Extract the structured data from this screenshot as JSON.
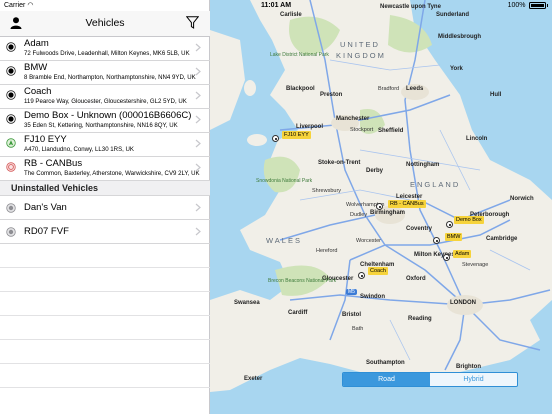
{
  "status_bar": {
    "carrier": "Carrier",
    "time": "11:01 AM",
    "battery": "100%"
  },
  "navbar": {
    "title": "Vehicles"
  },
  "vehicles_installed": [
    {
      "name": "Adam",
      "address": "72 Fulwoods Drive, Leadenhall, Milton Keynes, MK6 5LB, UK",
      "status": "online"
    },
    {
      "name": "BMW",
      "address": "8 Bramble End, Northampton, Northamptonshire, NN4 9YD, UK",
      "status": "online"
    },
    {
      "name": "Coach",
      "address": "119 Pearce Way, Gloucester, Gloucestershire, GL2 5YD, UK",
      "status": "online"
    },
    {
      "name": "Demo Box - Unknown (000016B6606C)",
      "address": "35 Eden St, Kettering, Northamptonshire, NN16 8QY, UK",
      "status": "online"
    },
    {
      "name": "FJ10 EYY",
      "address": "A470, Llandudno, Conwy, LL30 1RS, UK",
      "status": "moving"
    },
    {
      "name": "RB - CANBus",
      "address": "The Common, Baxterley, Atherstone, Warwickshire, CV9 2LY, UK",
      "status": "alert"
    }
  ],
  "section_uninstalled": "Uninstalled Vehicles",
  "vehicles_uninstalled": [
    {
      "name": "Dan's Van"
    },
    {
      "name": "RD07 FVF"
    }
  ],
  "map": {
    "country_label_1": "UNITED",
    "country_label_2": "KINGDOM",
    "england": "ENGLAND",
    "wales": "WALES",
    "cities": {
      "newcastle": "Newcastle upon Tyne",
      "sunderland": "Sunderland",
      "carlisle": "Carlisle",
      "middlesbrough": "Middlesbrough",
      "lake_district": "Lake District National Park",
      "york": "York",
      "leeds": "Leeds",
      "bradford": "Bradford",
      "blackpool": "Blackpool",
      "preston": "Preston",
      "hull": "Hull",
      "liverpool": "Liverpool",
      "manchester": "Manchester",
      "sheffield": "Sheffield",
      "lincoln": "Lincoln",
      "stoke": "Stoke-on-Trent",
      "derby": "Derby",
      "nottingham": "Nottingham",
      "snowdonia": "Snowdonia National Park",
      "leicester": "Leicester",
      "birmingham": "Birmingham",
      "norwich": "Norwich",
      "coventry": "Coventry",
      "peterborough": "Peterborough",
      "cambridge": "Cambridge",
      "milton_keynes": "Milton Keynes",
      "oxford": "Oxford",
      "gloucester": "Gloucester",
      "brecon": "Brecon Beacons National Park",
      "swindon": "Swindon",
      "cardiff": "Cardiff",
      "bristol": "Bristol",
      "london": "LONDON",
      "reading": "Reading",
      "southampton": "Southampton",
      "brighton": "Brighton",
      "swansea": "Swansea",
      "shrewsbury": "Shrewsbury",
      "dudley": "Dudley",
      "worcester": "Worcester",
      "hereford": "Hereford",
      "stevenage": "Stevenage",
      "bath": "Bath",
      "stockport": "Stockport",
      "wolverhampton": "Wolverhampton",
      "exeter": "Exeter",
      "cheltenham": "Cheltenham"
    },
    "tags": {
      "fj10": "FJ10 EYY",
      "rb": "RB - CANBus",
      "demo": "Demo Box",
      "bmw": "BMW",
      "adam": "Adam",
      "coach": "Coach"
    },
    "motorway_badge": "M5",
    "segment": {
      "road": "Road",
      "hybrid": "Hybrid"
    }
  }
}
